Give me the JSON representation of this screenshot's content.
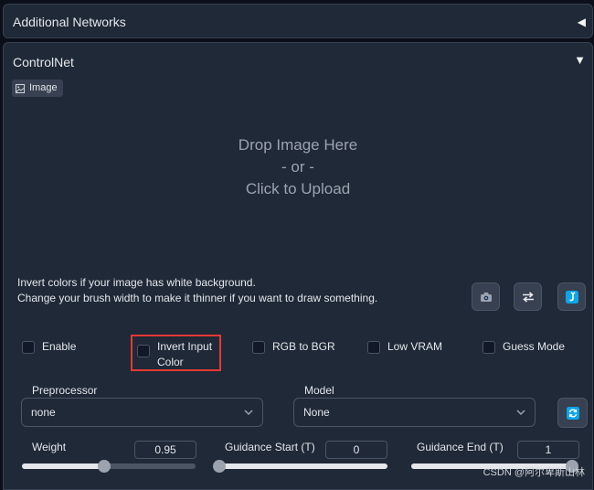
{
  "accordion_additional": {
    "title": "Additional Networks",
    "collapsed_icon": "triangle-left-icon"
  },
  "controlnet": {
    "title": "ControlNet",
    "expanded_icon": "triangle-down-icon",
    "image_tab": {
      "label": "Image",
      "icon": "image-icon"
    },
    "dropzone": {
      "line1": "Drop Image Here",
      "line2": "- or -",
      "line3": "Click to Upload"
    },
    "help": {
      "line1": "Invert colors if your image has white background.",
      "line2": "Change your brush width to make it thinner if you want to draw something."
    },
    "tools": [
      "camera-icon",
      "swap-arrows-icon",
      "send-arrow-icon"
    ],
    "checkboxes": {
      "enable": {
        "label": "Enable",
        "checked": false
      },
      "invert": {
        "label_line1": "Invert Input",
        "label_line2": "Color",
        "checked": false
      },
      "rgb": {
        "label": "RGB to BGR",
        "checked": false
      },
      "lowvram": {
        "label": "Low VRAM",
        "checked": false
      },
      "guess": {
        "label": "Guess Mode",
        "checked": false
      }
    },
    "preprocessor": {
      "label": "Preprocessor",
      "value": "none"
    },
    "model": {
      "label": "Model",
      "value": "None"
    },
    "weight": {
      "label": "Weight",
      "value": "0.95",
      "fraction": 0.475
    },
    "guidance_start": {
      "label": "Guidance Start (T)",
      "value": "0",
      "fraction": 0.0
    },
    "guidance_end": {
      "label": "Guidance End (T)",
      "value": "1",
      "fraction": 1.0
    }
  },
  "colors": {
    "highlight": "#e53935",
    "accent_blue": "#0ea5e9",
    "background": "#0b0f19",
    "panel": "#1f2937"
  },
  "watermark": "CSDN @阿尔卑斯山林"
}
